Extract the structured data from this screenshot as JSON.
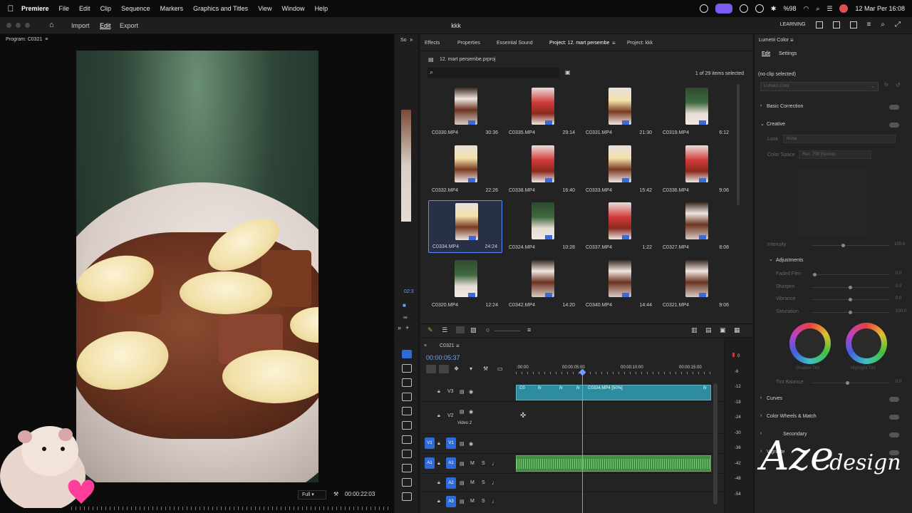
{
  "menubar": {
    "app": "Premiere",
    "items": [
      "File",
      "Edit",
      "Clip",
      "Sequence",
      "Markers",
      "Graphics and Titles",
      "View",
      "Window",
      "Help"
    ],
    "battery": "%98",
    "datetime": "12 Mar Per 16:08"
  },
  "titlebar": {
    "import": "Import",
    "edit": "Edit",
    "export": "Export",
    "project_title": "kkk",
    "workspace": "LEARNING"
  },
  "program": {
    "title": "Program: C0321",
    "fit": "Full",
    "timecode": "00:00:22:03",
    "src_timecode": "02:3"
  },
  "source_tab": "So",
  "project": {
    "tabs": [
      "Effects",
      "Properties",
      "Essential Sound",
      "Project: 12. mart persembe",
      "Project: kkk"
    ],
    "active_tab": 3,
    "file": "12. mart persembe.prproj",
    "selection_info": "1 of 29 items selected",
    "clips": [
      {
        "name": "C0330.MP4",
        "dur": "30:36",
        "thumb": "choc"
      },
      {
        "name": "C0335.MP4",
        "dur": "29:14",
        "thumb": "straw"
      },
      {
        "name": "C0331.MP4",
        "dur": "21:30",
        "thumb": "banana"
      },
      {
        "name": "C0319.MP4",
        "dur": "6:12",
        "thumb": "green"
      },
      {
        "name": "C0332.MP4",
        "dur": "22:26",
        "thumb": "banana"
      },
      {
        "name": "C0338.MP4",
        "dur": "16:40",
        "thumb": "straw"
      },
      {
        "name": "C0333.MP4",
        "dur": "15:42",
        "thumb": "banana"
      },
      {
        "name": "C0336.MP4",
        "dur": "9:06",
        "thumb": "straw"
      },
      {
        "name": "C0334.MP4",
        "dur": "24:24",
        "thumb": "banana"
      },
      {
        "name": "C0324.MP4",
        "dur": "10:28",
        "thumb": "green"
      },
      {
        "name": "C0337.MP4",
        "dur": "1:22",
        "thumb": "straw"
      },
      {
        "name": "C0327.MP4",
        "dur": "8:08",
        "thumb": "choc"
      },
      {
        "name": "C0320.MP4",
        "dur": "12:24",
        "thumb": "green"
      },
      {
        "name": "C0342.MP4",
        "dur": "14:20",
        "thumb": "choc"
      },
      {
        "name": "C0340.MP4",
        "dur": "14:44",
        "thumb": "choc"
      },
      {
        "name": "C0321.MP4",
        "dur": "9:06",
        "thumb": "choc"
      }
    ],
    "selected_index": 8
  },
  "timeline": {
    "sequence": "C0321",
    "timecode": "00:00:05:37",
    "ruler": [
      ":00:00",
      "00:00:05:00",
      "00:00:10:00",
      "00:00:15:00"
    ],
    "tracks": {
      "v3": "V3",
      "v2": "V2",
      "v2_name": "Video 2",
      "v1": "V1",
      "a1": "A1",
      "a2": "A2",
      "a3": "A3"
    },
    "clip_label": "C0334.MP4 [50%]",
    "clip_short": "C0",
    "fx": "fx"
  },
  "meter": {
    "scale": [
      "0",
      "-6",
      "-12",
      "-18",
      "-24",
      "-30",
      "-36",
      "-42",
      "-48",
      "-54"
    ]
  },
  "lumetri": {
    "title": "Lumetri Color",
    "tabs": [
      "Edit",
      "Settings"
    ],
    "no_clip": "(no clip selected)",
    "effect_dropdown": "Lumetri Color",
    "fx_label": "fx",
    "sections": {
      "basic": "Basic Correction",
      "creative": "Creative",
      "curves": "Curves",
      "wheels": "Color Wheels & Match",
      "hsl": "Secondary",
      "vignette": "Vignette"
    },
    "look_label": "Look",
    "look_value": "None",
    "colorspace_label": "Color Space",
    "colorspace_value": "Rec. 709 (Scene)",
    "intensity": {
      "label": "Intensity",
      "value": "100.0"
    },
    "adjustments": "Adjustments",
    "sliders": [
      {
        "label": "Faded Film",
        "value": "0.0"
      },
      {
        "label": "Sharpen",
        "value": "0.0"
      },
      {
        "label": "Vibrance",
        "value": "0.0"
      },
      {
        "label": "Saturation",
        "value": "100.0"
      }
    ],
    "shadow_tint": "Shadow Tint",
    "highlight_tint": "Highlight Tint",
    "tint_balance": {
      "label": "Tint Balance",
      "value": "0.0"
    }
  },
  "watermark": {
    "aze": "Aze",
    "design": "design"
  },
  "colors": {
    "accent": "#2f6ad9",
    "clip_blue": "#2d8ca0",
    "clip_green": "#3f8d3f",
    "selection": "#5b8cff"
  }
}
